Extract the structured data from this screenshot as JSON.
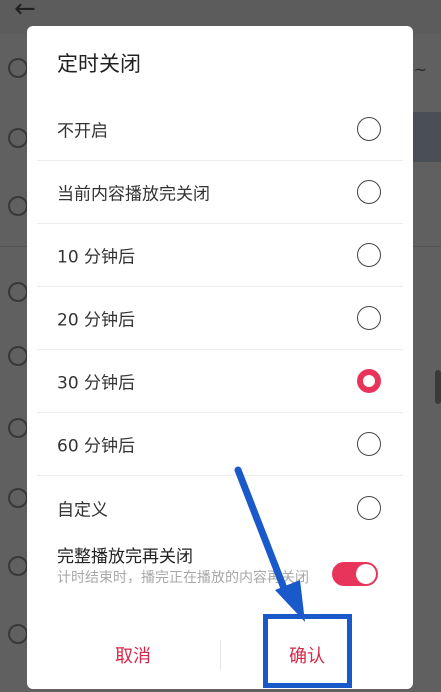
{
  "dialog": {
    "title": "定时关闭",
    "options": [
      {
        "label": "不开启",
        "selected": false
      },
      {
        "label": "当前内容播放完关闭",
        "selected": false
      },
      {
        "label": "10 分钟后",
        "selected": false
      },
      {
        "label": "20 分钟后",
        "selected": false
      },
      {
        "label": "30 分钟后",
        "selected": true
      },
      {
        "label": "60 分钟后",
        "selected": false
      },
      {
        "label": "自定义",
        "selected": false
      }
    ],
    "complete_play": {
      "title": "完整播放完再关闭",
      "description": "计时结束时，播完正在播放的内容再关闭",
      "enabled": true
    },
    "buttons": {
      "cancel": "取消",
      "confirm": "确认"
    }
  },
  "colors": {
    "accent": "#e8345a",
    "annotation": "#1a59c9"
  }
}
